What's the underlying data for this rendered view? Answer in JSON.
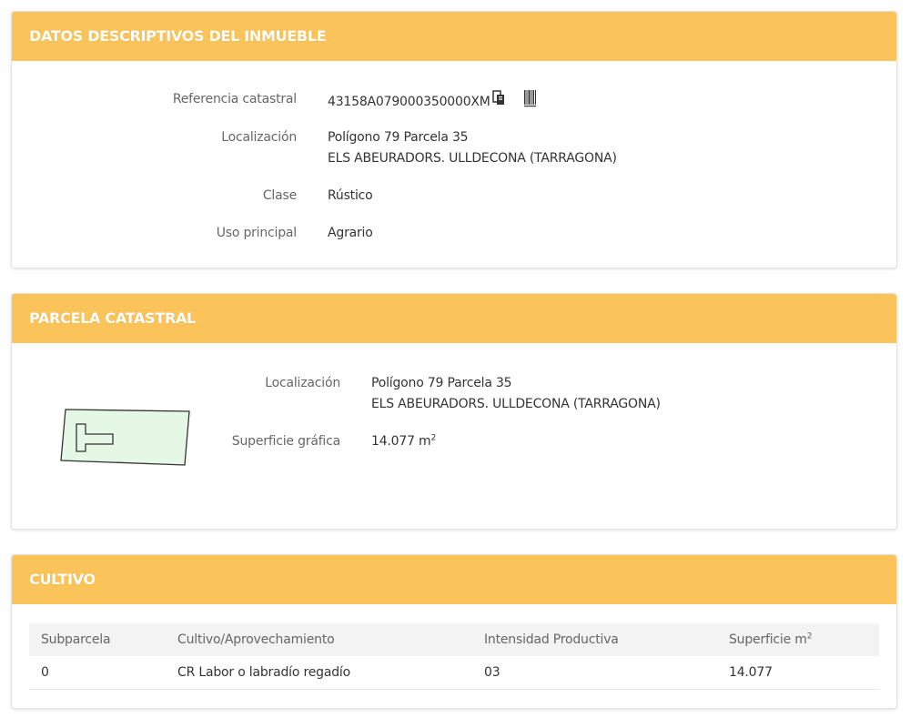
{
  "datos": {
    "title": "DATOS DESCRIPTIVOS DEL INMUEBLE",
    "referencia_label": "Referencia catastral",
    "referencia_value": "43158A079000350000XM",
    "copy_icon": "copy-icon",
    "barcode_icon": "barcode-icon",
    "localizacion_label": "Localización",
    "localizacion_line1": "Polígono 79 Parcela 35",
    "localizacion_line2": "ELS ABEURADORS. ULLDECONA (TARRAGONA)",
    "clase_label": "Clase",
    "clase_value": "Rústico",
    "uso_label": "Uso principal",
    "uso_value": "Agrario"
  },
  "parcela": {
    "title": "PARCELA CATASTRAL",
    "localizacion_label": "Localización",
    "localizacion_line1": "Polígono 79 Parcela 35",
    "localizacion_line2": "ELS ABEURADORS. ULLDECONA (TARRAGONA)",
    "superficie_label": "Superficie gráfica",
    "superficie_value": "14.077 m",
    "superficie_unit_sup": "2"
  },
  "cultivo": {
    "title": "CULTIVO",
    "headers": {
      "subparcela": "Subparcela",
      "cultivo": "Cultivo/Aprovechamiento",
      "intensidad": "Intensidad Productiva",
      "superficie": "Superficie m",
      "superficie_sup": "2"
    },
    "rows": [
      {
        "subparcela": "0",
        "cultivo": "CR Labor o labradío regadío",
        "intensidad": "03",
        "superficie": "14.077"
      }
    ]
  },
  "colors": {
    "header_bg": "#fac45b",
    "header_text": "#ffffff",
    "parcel_fill": "#e5f8e5",
    "parcel_stroke": "#333333"
  }
}
